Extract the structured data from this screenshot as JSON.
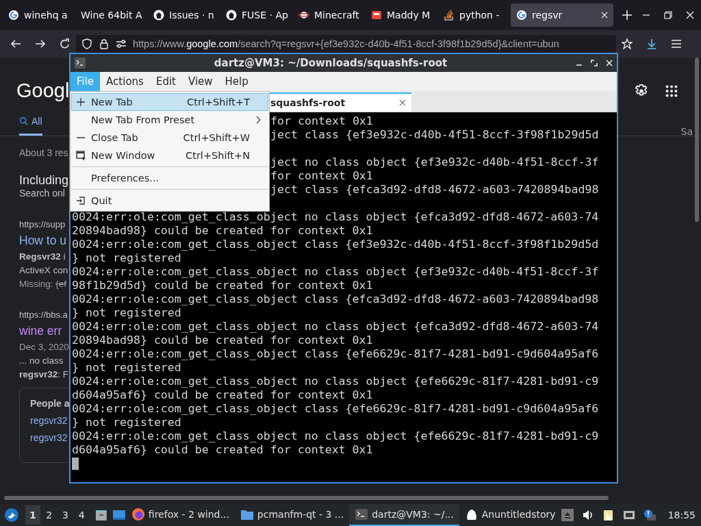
{
  "browser": {
    "tabs": [
      {
        "label": "winehq a",
        "kind": "google",
        "selected": false
      },
      {
        "label": "Wine 64bit A",
        "kind": "blank",
        "selected": false
      },
      {
        "label": "Issues · n",
        "kind": "github",
        "selected": false
      },
      {
        "label": "FUSE · Ap",
        "kind": "github",
        "selected": false
      },
      {
        "label": "Minecraft",
        "kind": "planet",
        "selected": false
      },
      {
        "label": "Maddy M",
        "kind": "red",
        "selected": false
      },
      {
        "label": "python - ",
        "kind": "stack",
        "selected": false
      },
      {
        "label": "regsvr",
        "kind": "google",
        "selected": true
      }
    ],
    "address": {
      "prefix": "https://www.",
      "host": "google.com",
      "rest": "/search?q=regsvr+{ef3e932c-d40b-4f51-8ccf-3f98f1b29d5d}&client=ubun"
    },
    "page": {
      "logo": "Googl",
      "search_tabs": [
        {
          "label": "All",
          "selected": true
        }
      ],
      "result_count": "About 3 res",
      "notice": {
        "title": "Including",
        "subtitle": "Search onl"
      },
      "results": [
        {
          "url": "https://supp",
          "title": "How to u",
          "visited": false,
          "lines": [
            {
              "kind": "text",
              "text": "**Regsvr32** i"
            },
            {
              "kind": "text",
              "text": "ActiveX con"
            },
            {
              "kind": "missing",
              "label": "Missing:",
              "term": "{ef"
            }
          ]
        },
        {
          "url": "https://bbs.a",
          "title": "wine err",
          "visited": true,
          "lines": [
            {
              "kind": "date",
              "text": "Dec 3, 2020"
            },
            {
              "kind": "text",
              "text": "... no class"
            },
            {
              "kind": "text",
              "text": "**regsvr32**: F"
            }
          ]
        }
      ],
      "people_also": {
        "title": "People a",
        "links": [
          "regsvr32",
          "regsvr32"
        ]
      },
      "right_label": "Sa"
    }
  },
  "terminal": {
    "title": "dartz@VM3: ~/Downloads/squashfs-root",
    "menus": [
      {
        "label": "File",
        "selected": true
      },
      {
        "label": "Actions",
        "selected": false
      },
      {
        "label": "Edit",
        "selected": false
      },
      {
        "label": "View",
        "selected": false
      },
      {
        "label": "Help",
        "selected": false
      }
    ],
    "tab": {
      "label": "squashfs-root"
    },
    "covered_lines": [
      {
        "kind": "text",
        "text": "for context 0x1"
      },
      {
        "kind": "text",
        "text": "ject class {ef3e932c-d40b-4f51-8ccf-3f98f1b29d5d"
      },
      {
        "kind": "hidden"
      },
      {
        "kind": "text",
        "text": "ject no class object {ef3e932c-d40b-4f51-8ccf-3f"
      },
      {
        "kind": "text",
        "text": "for context 0x1"
      },
      {
        "kind": "text",
        "text": "ject class {efca3d92-dfd8-4672-a603-7420894bad98"
      },
      {
        "kind": "hidden"
      }
    ],
    "lines": [
      "0024:err:ole:com_get_class_object no class object {efca3d92-dfd8-4672-a603-74",
      "20894bad98} could be created for context 0x1",
      "0024:err:ole:com_get_class_object class {ef3e932c-d40b-4f51-8ccf-3f98f1b29d5d",
      "} not registered",
      "0024:err:ole:com_get_class_object no class object {ef3e932c-d40b-4f51-8ccf-3f",
      "98f1b29d5d} could be created for context 0x1",
      "0024:err:ole:com_get_class_object class {efca3d92-dfd8-4672-a603-7420894bad98",
      "} not registered",
      "0024:err:ole:com_get_class_object no class object {efca3d92-dfd8-4672-a603-74",
      "20894bad98} could be created for context 0x1",
      "0024:err:ole:com_get_class_object class {efe6629c-81f7-4281-bd91-c9d604a95af6",
      "} not registered",
      "0024:err:ole:com_get_class_object no class object {efe6629c-81f7-4281-bd91-c9",
      "d604a95af6} could be created for context 0x1",
      "0024:err:ole:com_get_class_object class {efe6629c-81f7-4281-bd91-c9d604a95af6",
      "} not registered",
      "0024:err:ole:com_get_class_object no class object {efe6629c-81f7-4281-bd91-c9",
      "d604a95af6} could be created for context 0x1"
    ]
  },
  "file_menu": {
    "items": [
      {
        "kind": "plus",
        "label": "New Tab",
        "shortcut": "Ctrl+Shift+T",
        "submenu": false,
        "selected": true
      },
      {
        "kind": "plain",
        "label": "New Tab From Preset",
        "submenu": true,
        "selected": false
      },
      {
        "kind": "minus",
        "label": "Close Tab",
        "shortcut": "Ctrl+Shift+W",
        "submenu": false,
        "selected": false
      },
      {
        "kind": "window",
        "label": "New Window",
        "shortcut": "Ctrl+Shift+N",
        "submenu": false,
        "selected": false
      },
      {
        "kind": "separator"
      },
      {
        "kind": "plain",
        "label": "Preferences...",
        "submenu": false,
        "selected": false
      },
      {
        "kind": "separator"
      },
      {
        "kind": "exit",
        "label": "Quit",
        "submenu": false,
        "selected": false
      }
    ]
  },
  "taskbar": {
    "workspaces": [
      {
        "label": "1",
        "selected": true
      },
      {
        "label": "2",
        "selected": false
      },
      {
        "label": "3",
        "selected": false
      },
      {
        "label": "4",
        "selected": false
      }
    ],
    "tasks": [
      {
        "label": "firefox - 2 wind...",
        "kind": "firefox",
        "selected": false
      },
      {
        "label": "pcmanfm-qt - 3 ...",
        "kind": "folder",
        "selected": false
      },
      {
        "label": "dartz@VM3: ~/...",
        "kind": "terminal",
        "selected": true
      },
      {
        "label": "Anuntitledstory",
        "kind": "ghost",
        "selected": false
      }
    ],
    "clock": "18:55"
  }
}
